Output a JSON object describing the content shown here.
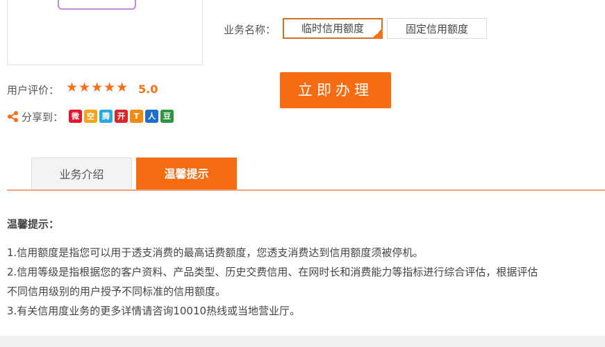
{
  "business": {
    "label": "业务名称：",
    "options": [
      {
        "label": "临时信用额度",
        "selected": true
      },
      {
        "label": "固定信用额度",
        "selected": false
      }
    ]
  },
  "rating": {
    "label": "用户评价：",
    "stars": "★★★★★",
    "score": "5.0",
    "value": 5.0,
    "max": 5
  },
  "apply_button": "立即办理",
  "share": {
    "label": "分享到：",
    "icons": [
      {
        "name": "weibo-icon",
        "glyph": "微",
        "color": "#e6162d"
      },
      {
        "name": "qzone-icon",
        "glyph": "空",
        "color": "#f3a41b"
      },
      {
        "name": "tencent-weibo-icon",
        "glyph": "腾",
        "color": "#2aa8e0"
      },
      {
        "name": "kaixin-icon",
        "glyph": "开",
        "color": "#d8262a"
      },
      {
        "name": "tianya-icon",
        "glyph": "T",
        "color": "#f08a13"
      },
      {
        "name": "renren-icon",
        "glyph": "人",
        "color": "#1f6fc5"
      },
      {
        "name": "douban-icon",
        "glyph": "豆",
        "color": "#2e963d"
      }
    ]
  },
  "tabs": [
    {
      "label": "业务介绍",
      "active": false
    },
    {
      "label": "温馨提示",
      "active": true
    }
  ],
  "notice": {
    "title": "温馨提示：",
    "lines": [
      "1.信用额度是指您可以用于透支消费的最高话费额度，您透支消费达到信用额度须被停机。",
      "2.信用等级是指根据您的客户资料、产品类型、历史交费信用、在网时长和消费能力等指标进行综合评估，根据评估",
      "不同信用级别的用户授予不同标准的信用额度。",
      "3.有关信用度业务的更多详情请咨询10010热线或当地营业厅。"
    ]
  },
  "colors": {
    "accent": "#f66c12",
    "selected_border": "#d46f23"
  }
}
